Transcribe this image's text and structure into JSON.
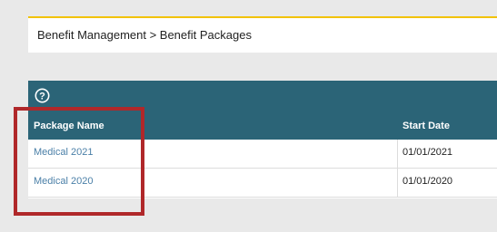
{
  "breadcrumb": {
    "text": "Benefit Management > Benefit Packages"
  },
  "table": {
    "help_glyph": "?",
    "columns": {
      "package_name": "Package Name",
      "start_date": "Start Date"
    },
    "rows": [
      {
        "package_name": "Medical 2021",
        "start_date": "01/01/2021"
      },
      {
        "package_name": "Medical 2020",
        "start_date": "01/01/2020"
      }
    ]
  },
  "colors": {
    "header_bg": "#2b6477",
    "accent_yellow": "#f2c200",
    "link": "#4a7fa7",
    "highlight": "#b0282a"
  }
}
